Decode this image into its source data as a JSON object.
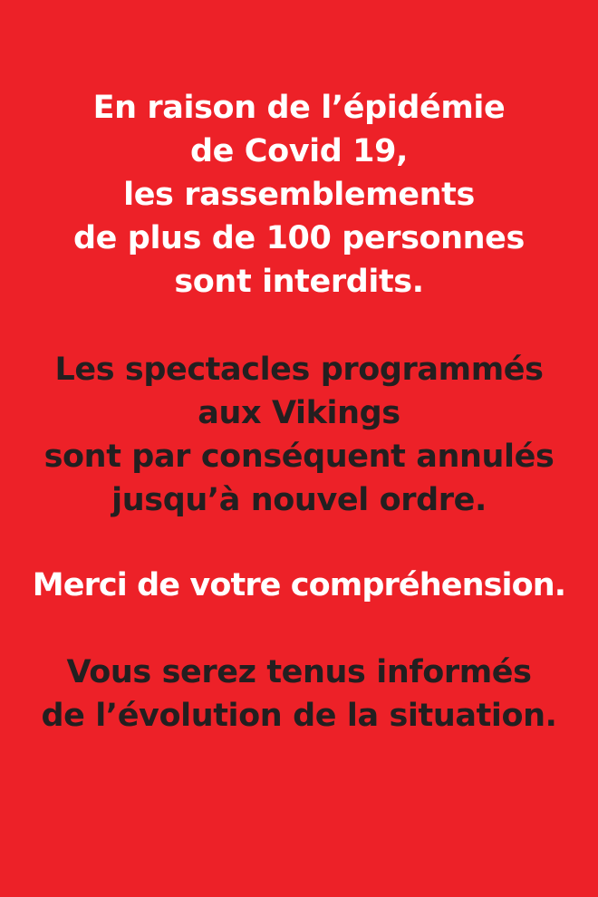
{
  "notice": {
    "background_color": "#ed2128",
    "white_text_color": "#ffffff",
    "dark_text_color": "#231f20",
    "block_1": {
      "lines": [
        "En raison de l’épidémie",
        "de Covid 19,",
        "les rassemblements",
        "de plus de 100 personnes",
        "sont interdits."
      ]
    },
    "block_2": {
      "lines": [
        "Les spectacles programmés",
        "aux Vikings",
        "sont par conséquent annulés",
        "jusqu’à nouvel ordre."
      ]
    },
    "block_3": {
      "lines": [
        "Merci de votre compréhension."
      ]
    },
    "block_4": {
      "lines": [
        "Vous serez tenus informés",
        "de l’évolution de la situation."
      ]
    }
  }
}
